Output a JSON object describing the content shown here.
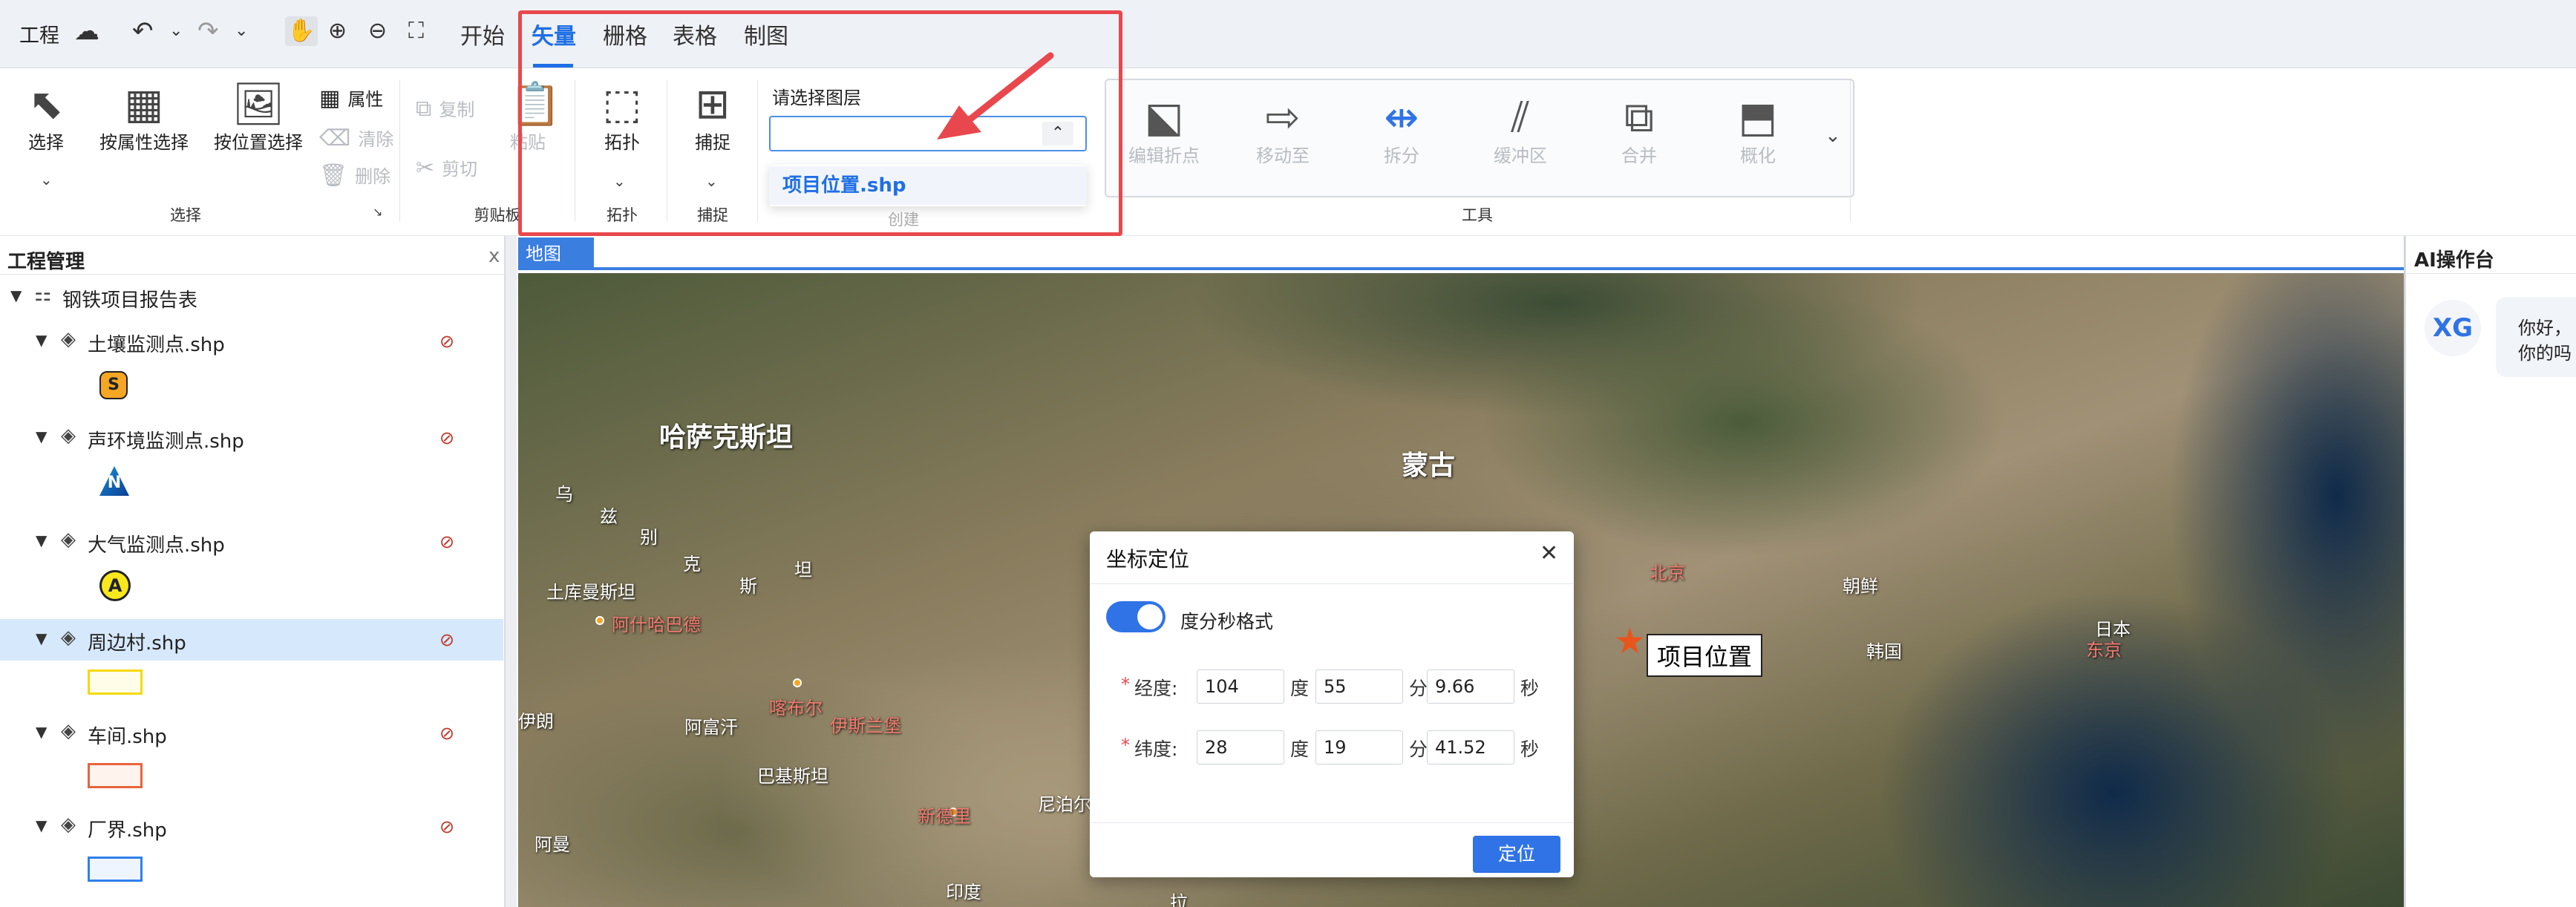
{
  "topbar": {
    "app_menu": "工程",
    "tabs": [
      "开始",
      "矢量",
      "栅格",
      "表格",
      "制图"
    ],
    "active_tab": "矢量"
  },
  "ribbon": {
    "select_group": {
      "select": "选择",
      "select_by_attr": "按属性选择",
      "select_by_location": "按位置选择",
      "attributes": "属性",
      "clear": "清除",
      "delete": "删除",
      "label": "选择"
    },
    "clipboard_group": {
      "copy": "复制",
      "paste": "粘贴",
      "cut": "剪切",
      "label": "剪贴板"
    },
    "topology_group": {
      "button": "拓扑",
      "label": "拓扑"
    },
    "snap_group": {
      "button": "捕捉",
      "label": "捕捉"
    },
    "create_group": {
      "layer_prompt": "请选择图层",
      "selected_value": "",
      "options": [
        "项目位置.shp"
      ],
      "label": "创建"
    },
    "tools_group": {
      "buttons": [
        "编辑折点",
        "移动至",
        "拆分",
        "缓冲区",
        "合并",
        "概化"
      ],
      "label": "工具"
    }
  },
  "project_panel": {
    "title": "工程管理",
    "close": "x",
    "root": "钢铁项目报告表",
    "layers": [
      {
        "name": "土壤监测点.shp",
        "symbol": "S",
        "symbol_color": "#f5a623"
      },
      {
        "name": "声环境监测点.shp",
        "symbol": "N",
        "symbol_color": "#2c6fd6"
      },
      {
        "name": "大气监测点.shp",
        "symbol": "A",
        "symbol_color": "#f8e71c"
      },
      {
        "name": "周边村.shp",
        "symbol": "",
        "symbol_color": "#f5d90a"
      },
      {
        "name": "车间.shp",
        "symbol": "",
        "symbol_color": "#e8643c"
      },
      {
        "name": "厂界.shp",
        "symbol": "",
        "symbol_color": "#2f80ed"
      }
    ],
    "selected_layer": "周边村.shp"
  },
  "map": {
    "tab": "地图",
    "labels": [
      "哈萨克斯坦",
      "蒙古",
      "乌",
      "兹",
      "别",
      "克",
      "斯",
      "坦",
      "土库曼斯坦",
      "阿什哈巴德",
      "朝鲜",
      "韩国",
      "日本",
      "东京",
      "北京",
      "喀布尔",
      "伊斯兰堡",
      "阿富汗",
      "巴基斯坦",
      "新德里",
      "伊朗",
      "阿曼",
      "尼泊尔",
      "印度",
      "拉"
    ],
    "project_marker_label": "项目位置"
  },
  "dialog": {
    "title": "坐标定位",
    "toggle_label": "度分秒格式",
    "toggle_on": true,
    "longitude_label": "经度:",
    "latitude_label": "纬度:",
    "longitude": {
      "deg": "104",
      "min": "55",
      "sec": "9.66"
    },
    "latitude": {
      "deg": "28",
      "min": "19",
      "sec": "41.52"
    },
    "unit_deg": "度",
    "unit_min": "分",
    "unit_sec": "秒",
    "required_mark": "*",
    "confirm": "定位"
  },
  "ai_panel": {
    "title": "AI操作台",
    "avatar": "XG",
    "message_line1": "你好，",
    "message_line2": "你的吗"
  },
  "colors": {
    "accent": "#1f6fe5",
    "highlight_box": "#e8484d",
    "selected_row": "#d6e8fb"
  }
}
